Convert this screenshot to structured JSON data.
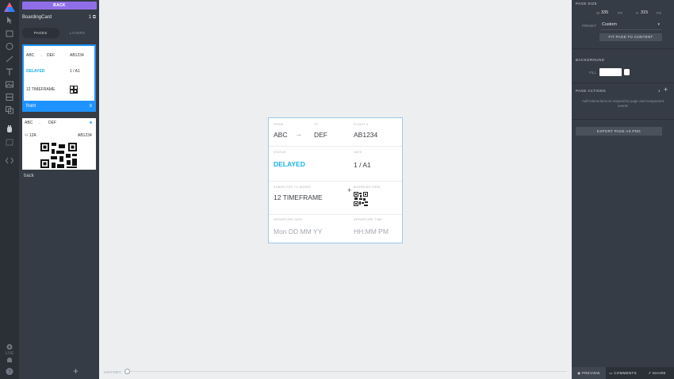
{
  "rail": {
    "tools": [
      "pointer-icon",
      "rectangle-icon",
      "ellipse-icon",
      "line-icon",
      "text-icon",
      "image-icon",
      "component-icon",
      "layers-icon",
      "hand-icon",
      "frame-icon",
      "code-icon"
    ],
    "bottom_label": "LIVE"
  },
  "pages_panel": {
    "back_label": "BACK",
    "doc_title": "BoardingCard",
    "doc_count": "1",
    "tab_pages": "PAGES",
    "tab_layers": "LAYERS",
    "pages": [
      {
        "label": "front",
        "mini": {
          "from_code": "ABC",
          "to_code": "DEF",
          "flight": "AB1234",
          "status": "DELAYED",
          "gate": "1 / A1",
          "board": "12 TIMEFRAME"
        }
      },
      {
        "label": "back",
        "mini": {
          "from_code": "ABC",
          "to_code": "DEF",
          "seat": "12A",
          "flight": "AB1234"
        }
      }
    ]
  },
  "canvas": {
    "history_label": "HISTORY",
    "card": {
      "from_label": "FROM",
      "from_value": "ABC",
      "to_label": "TO",
      "to_value": "DEF",
      "flight_label": "FLIGHT #",
      "flight_value": "AB1234",
      "status_label": "STATUS",
      "status_value": "DELAYED",
      "gate_label": "GATE",
      "gate_value": "1 / A1",
      "board_label": "SUBJECTED TO BOARD",
      "board_value": "12 TIMEFRAME",
      "pass_label": "BOARDING PASS",
      "dep_date_label": "DEPARTURE DATE",
      "dep_date_value": "Mon DD MM YY",
      "dep_time_label": "DEPARTURE TIME",
      "dep_time_value": "HH:MM PM",
      "arrow": "→"
    }
  },
  "inspector": {
    "page_size_label": "PAGE SIZE",
    "w_label": "W",
    "w_value": "335",
    "w_unit": "PX",
    "h_label": "H",
    "h_value": "315",
    "h_unit": "PX",
    "preset_label": "PRESET",
    "preset_value": "Custom",
    "fit_label": "FIT PAGE TO CONTENT",
    "background_label": "BACKGROUND",
    "fill_label": "FILL",
    "fill_color": "#ffffff",
    "page_actions_label": "PAGE ACTIONS",
    "page_actions_count": "1",
    "page_actions_hint": "Add interactions to respond to page and component events",
    "export_label": "EXPORT PAGE AS PNG",
    "preview_label": "PREVIEW",
    "comments_label": "COMMENTS",
    "share_label": "SHARE"
  },
  "colors": {
    "accent": "#8f6fe8",
    "selection": "#1e93ff",
    "status": "#19b3e6",
    "panel": "#363c45",
    "rail": "#2b3037"
  }
}
